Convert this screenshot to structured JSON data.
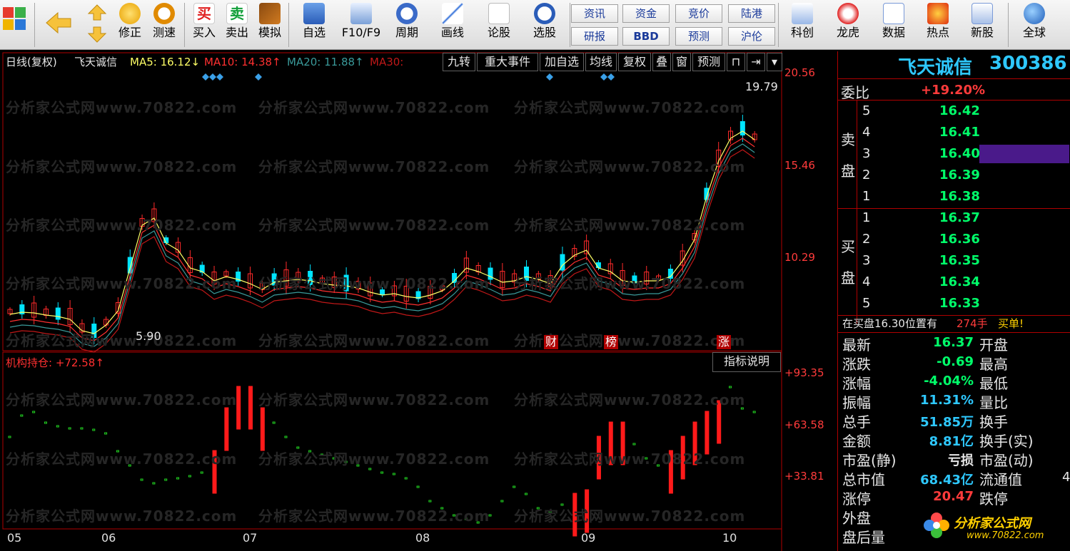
{
  "toolbar": {
    "items": [
      {
        "label": "修正"
      },
      {
        "label": "测速"
      },
      {
        "label": "买入"
      },
      {
        "label": "卖出"
      },
      {
        "label": "模拟"
      },
      {
        "label": "自选"
      },
      {
        "label": "F10/F9"
      },
      {
        "label": "周期"
      },
      {
        "label": "画线"
      },
      {
        "label": "论股"
      },
      {
        "label": "选股"
      },
      {
        "label": "科创"
      },
      {
        "label": "龙虎"
      },
      {
        "label": "数据"
      },
      {
        "label": "热点"
      },
      {
        "label": "新股"
      },
      {
        "label": "全球"
      }
    ],
    "small_buttons": [
      "资讯",
      "资金",
      "竞价",
      "陆港",
      "研报",
      "BBD",
      "预测",
      "沪伦"
    ],
    "icon_texts": {
      "buy": "买",
      "sell": "卖"
    }
  },
  "chart": {
    "period_label": "日线(复权)",
    "stock_name": "飞天诚信",
    "ma5": "MA5: 16.12↓",
    "ma10": "MA10: 14.38↑",
    "ma20": "MA20: 11.88↑",
    "ma30": "MA30:",
    "tool_buttons": [
      "九转",
      "重大事件",
      "加自选",
      "均线",
      "复权",
      "叠",
      "窗",
      "预测"
    ],
    "price_axis": [
      "20.56",
      "15.46",
      "10.29"
    ],
    "high_label": "19.79",
    "low_label": "5.90",
    "event_tags": [
      "财",
      "榜",
      "涨"
    ],
    "months": [
      "05",
      "06",
      "07",
      "08",
      "09",
      "10"
    ],
    "indicator_title": "机构持仓: +72.58↑",
    "indicator_btn": "指标说明",
    "indicator_axis": [
      "+93.35",
      "+63.58",
      "+33.81"
    ],
    "watermark": "分析家公式网www.70822.com",
    "colors": {
      "up": "#ff2a2a",
      "down": "#00e5ff",
      "ma5": "#ffff66",
      "ma10": "#ff3030",
      "ma20": "#3a9a9a",
      "ma30": "#c01818",
      "ind_up": "#ff1a1a",
      "ind_down": "#22d422"
    }
  },
  "panel": {
    "name": "飞天诚信",
    "code": "300386",
    "weibi_label": "委比",
    "weibi_value": "+19.20%",
    "sell_label": [
      "卖",
      "盘"
    ],
    "buy_label": [
      "买",
      "盘"
    ],
    "sell": [
      {
        "lvl": "5",
        "price": "16.42"
      },
      {
        "lvl": "4",
        "price": "16.41"
      },
      {
        "lvl": "3",
        "price": "16.40"
      },
      {
        "lvl": "2",
        "price": "16.39"
      },
      {
        "lvl": "1",
        "price": "16.38"
      }
    ],
    "buy": [
      {
        "lvl": "1",
        "price": "16.37"
      },
      {
        "lvl": "2",
        "price": "16.36"
      },
      {
        "lvl": "3",
        "price": "16.35"
      },
      {
        "lvl": "4",
        "price": "16.34"
      },
      {
        "lvl": "5",
        "price": "16.33"
      }
    ],
    "notice_a": "在买盘16.30位置有",
    "notice_b": "274手",
    "notice_c": "买单!",
    "stats": [
      {
        "l": "最新",
        "v": "16.37",
        "c": "#00ff6a",
        "r": "开盘"
      },
      {
        "l": "涨跌",
        "v": "-0.69",
        "c": "#00ff6a",
        "r": "最高"
      },
      {
        "l": "涨幅",
        "v": "-4.04%",
        "c": "#00ff6a",
        "r": "最低"
      },
      {
        "l": "振幅",
        "v": "11.31%",
        "c": "#2ec8ff",
        "r": "量比"
      },
      {
        "l": "总手",
        "v": "51.85万",
        "c": "#2ec8ff",
        "r": "换手"
      },
      {
        "l": "金额",
        "v": "8.81亿",
        "c": "#2ec8ff",
        "r": "换手(实)"
      },
      {
        "l": "市盈(静)",
        "v": "亏损",
        "c": "#e6e6e6",
        "r": "市盈(动)"
      },
      {
        "l": "总市值",
        "v": "68.43亿",
        "c": "#2ec8ff",
        "r": "流通值"
      },
      {
        "l": "涨停",
        "v": "20.47",
        "c": "#ff3b3b",
        "r": "跌停"
      },
      {
        "l": "外盘",
        "v": "",
        "c": "#e6e6e6",
        "r": ""
      },
      {
        "l": "盘后量",
        "v": "",
        "c": "#e6e6e6",
        "r": ""
      }
    ],
    "extra_4": "4",
    "logo_text": "分析家公式网",
    "logo_url": "www.70822.com"
  }
}
